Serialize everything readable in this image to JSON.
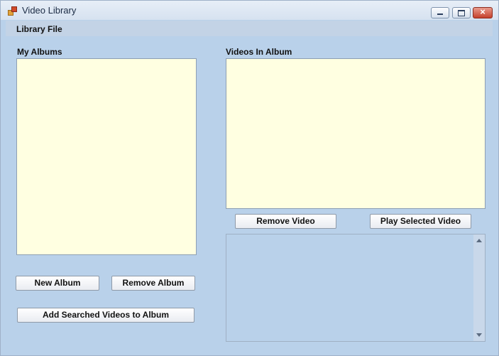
{
  "window": {
    "title": "Video Library",
    "controls": {
      "minimize": "minimize",
      "maximize": "maximize",
      "close": "×"
    }
  },
  "menubar": {
    "items": [
      "Library File"
    ]
  },
  "albums": {
    "label": "My Albums",
    "new_album_label": "New Album",
    "remove_album_label": "Remove Album",
    "add_searched_label": "Add Searched Videos to Album"
  },
  "videos": {
    "label": "Videos In Album",
    "remove_video_label": "Remove Video",
    "play_selected_label": "Play Selected Video"
  },
  "icons": {
    "app": "app-icon",
    "minimize": "minimize-icon",
    "maximize": "maximize-icon",
    "close": "close-icon",
    "scroll_up": "arrow-up-icon",
    "scroll_down": "arrow-down-icon"
  },
  "colors": {
    "window_bg": "#b9d1ea",
    "listbox_bg": "#ffffe1"
  }
}
